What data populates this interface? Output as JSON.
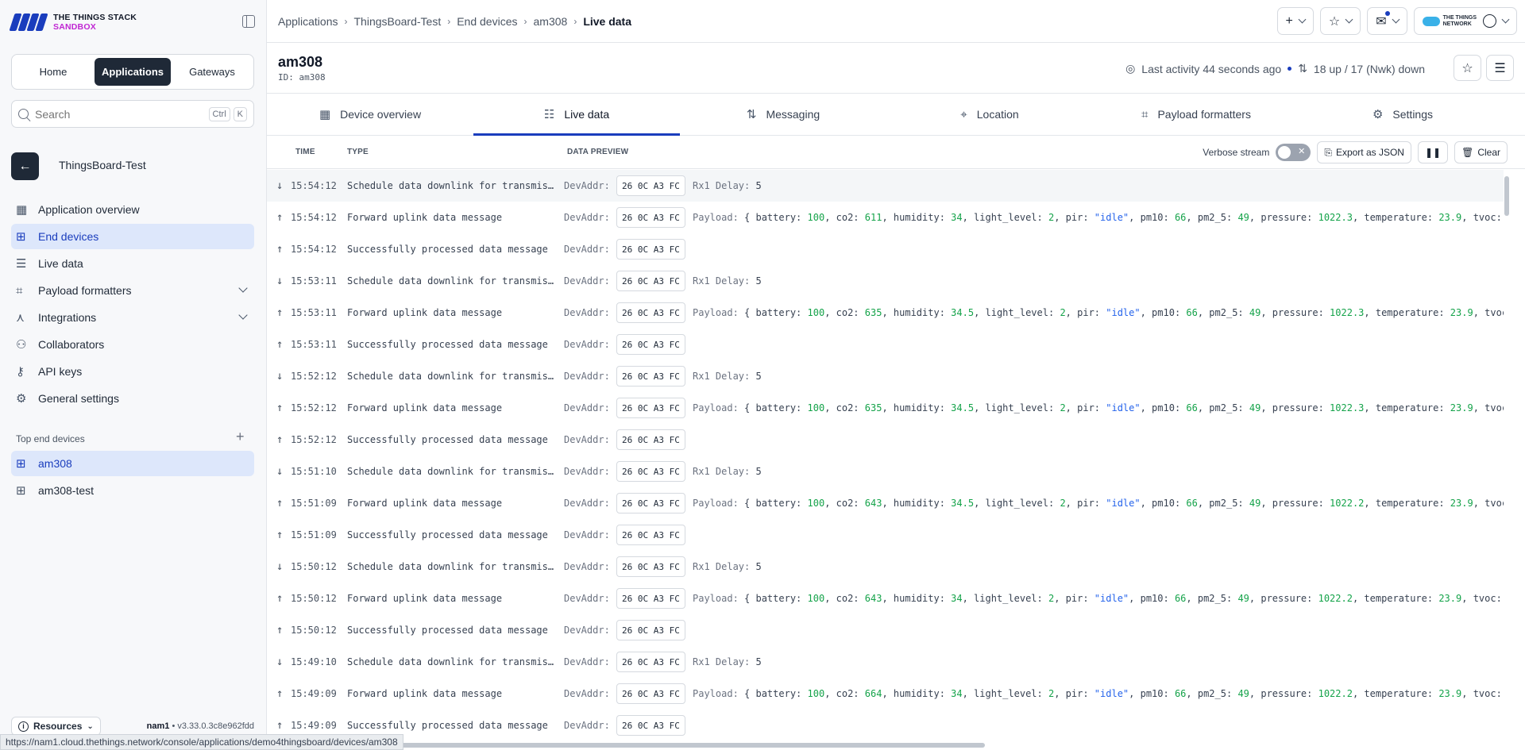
{
  "brand": {
    "line1": "THE THINGS STACK",
    "line2": "SANDBOX"
  },
  "segmented": [
    "Home",
    "Applications",
    "Gateways"
  ],
  "search": {
    "placeholder": "Search",
    "key1": "Ctrl",
    "key2": "K"
  },
  "app": {
    "name": "ThingsBoard-Test"
  },
  "nav": [
    {
      "label": "Application overview",
      "icon": "grid-icon"
    },
    {
      "label": "End devices",
      "icon": "chip-icon",
      "active": true
    },
    {
      "label": "Live data",
      "icon": "list-icon"
    },
    {
      "label": "Payload formatters",
      "icon": "code-icon"
    },
    {
      "label": "Integrations",
      "icon": "integration-icon"
    },
    {
      "label": "Collaborators",
      "icon": "users-icon"
    },
    {
      "label": "API keys",
      "icon": "key-icon"
    },
    {
      "label": "General settings",
      "icon": "gear-icon"
    }
  ],
  "top_devices": {
    "heading": "Top end devices",
    "items": [
      "am308",
      "am308-test"
    ]
  },
  "footer": {
    "resources": "Resources",
    "cluster": "nam1",
    "version": "v3.33.0.3c8e962fdd"
  },
  "breadcrumbs": [
    "Applications",
    "ThingsBoard-Test",
    "End devices",
    "am308",
    "Live data"
  ],
  "device": {
    "name": "am308",
    "id": "ID: am308",
    "last_activity": "Last activity 44 seconds ago",
    "counters": "18 up / 17 (Nwk) down"
  },
  "tabs": [
    "Device overview",
    "Live data",
    "Messaging",
    "Location",
    "Payload formatters",
    "Settings"
  ],
  "table": {
    "headers": [
      "TIME",
      "TYPE",
      "DATA PREVIEW"
    ],
    "verbose_label": "Verbose stream",
    "export_label": "Export as JSON",
    "clear_label": "Clear"
  },
  "events": [
    {
      "dir": "down",
      "time": "15:54:12",
      "type": "Schedule data downlink for transmis…",
      "addr_label": "DevAddr:",
      "addr": "26 0C A3 FC",
      "kind": "rx1",
      "extra_label": "Rx1 Delay:",
      "extra_value": "5"
    },
    {
      "dir": "up",
      "time": "15:54:12",
      "type": "Forward uplink data message",
      "addr_label": "DevAddr:",
      "addr": "26 0C A3 FC",
      "kind": "payload",
      "co2": "611",
      "humidity": "34",
      "pressure": "1022.3",
      "tail": "tvoc: :"
    },
    {
      "dir": "up",
      "time": "15:54:12",
      "type": "Successfully processed data message",
      "addr_label": "DevAddr:",
      "addr": "26 0C A3 FC",
      "kind": "none"
    },
    {
      "dir": "down",
      "time": "15:53:11",
      "type": "Schedule data downlink for transmis…",
      "addr_label": "DevAddr:",
      "addr": "26 0C A3 FC",
      "kind": "rx1",
      "extra_label": "Rx1 Delay:",
      "extra_value": "5"
    },
    {
      "dir": "up",
      "time": "15:53:11",
      "type": "Forward uplink data message",
      "addr_label": "DevAddr:",
      "addr": "26 0C A3 FC",
      "kind": "payload",
      "co2": "635",
      "humidity": "34.5",
      "pressure": "1022.3",
      "tail": "tvoc"
    },
    {
      "dir": "up",
      "time": "15:53:11",
      "type": "Successfully processed data message",
      "addr_label": "DevAddr:",
      "addr": "26 0C A3 FC",
      "kind": "none"
    },
    {
      "dir": "down",
      "time": "15:52:12",
      "type": "Schedule data downlink for transmis…",
      "addr_label": "DevAddr:",
      "addr": "26 0C A3 FC",
      "kind": "rx1",
      "extra_label": "Rx1 Delay:",
      "extra_value": "5"
    },
    {
      "dir": "up",
      "time": "15:52:12",
      "type": "Forward uplink data message",
      "addr_label": "DevAddr:",
      "addr": "26 0C A3 FC",
      "kind": "payload",
      "co2": "635",
      "humidity": "34.5",
      "pressure": "1022.3",
      "tail": "tvoc"
    },
    {
      "dir": "up",
      "time": "15:52:12",
      "type": "Successfully processed data message",
      "addr_label": "DevAddr:",
      "addr": "26 0C A3 FC",
      "kind": "none"
    },
    {
      "dir": "down",
      "time": "15:51:10",
      "type": "Schedule data downlink for transmis…",
      "addr_label": "DevAddr:",
      "addr": "26 0C A3 FC",
      "kind": "rx1",
      "extra_label": "Rx1 Delay:",
      "extra_value": "5"
    },
    {
      "dir": "up",
      "time": "15:51:09",
      "type": "Forward uplink data message",
      "addr_label": "DevAddr:",
      "addr": "26 0C A3 FC",
      "kind": "payload",
      "co2": "643",
      "humidity": "34.5",
      "pressure": "1022.2",
      "tail": "tvoc"
    },
    {
      "dir": "up",
      "time": "15:51:09",
      "type": "Successfully processed data message",
      "addr_label": "DevAddr:",
      "addr": "26 0C A3 FC",
      "kind": "none"
    },
    {
      "dir": "down",
      "time": "15:50:12",
      "type": "Schedule data downlink for transmis…",
      "addr_label": "DevAddr:",
      "addr": "26 0C A3 FC",
      "kind": "rx1",
      "extra_label": "Rx1 Delay:",
      "extra_value": "5"
    },
    {
      "dir": "up",
      "time": "15:50:12",
      "type": "Forward uplink data message",
      "addr_label": "DevAddr:",
      "addr": "26 0C A3 FC",
      "kind": "payload",
      "co2": "643",
      "humidity": "34",
      "pressure": "1022.2",
      "tail": "tvoc: :"
    },
    {
      "dir": "up",
      "time": "15:50:12",
      "type": "Successfully processed data message",
      "addr_label": "DevAddr:",
      "addr": "26 0C A3 FC",
      "kind": "none"
    },
    {
      "dir": "down",
      "time": "15:49:10",
      "type": "Schedule data downlink for transmis…",
      "addr_label": "DevAddr:",
      "addr": "26 0C A3 FC",
      "kind": "rx1",
      "extra_label": "Rx1 Delay:",
      "extra_value": "5"
    },
    {
      "dir": "up",
      "time": "15:49:09",
      "type": "Forward uplink data message",
      "addr_label": "DevAddr:",
      "addr": "26 0C A3 FC",
      "kind": "payload",
      "co2": "664",
      "humidity": "34",
      "pressure": "1022.2",
      "tail": "tvoc: :"
    },
    {
      "dir": "up",
      "time": "15:49:09",
      "type": "Successfully processed data message",
      "addr_label": "DevAddr:",
      "addr": "26 0C A3 FC",
      "kind": "none"
    }
  ],
  "payload_common": {
    "prefix": "Payload:",
    "battery": "100",
    "light_level": "2",
    "pir": "\"idle\"",
    "pm10": "66",
    "pm2_5": "49",
    "temperature": "23.9"
  },
  "status_url": "https://nam1.cloud.thethings.network/console/applications/demo4thingsboard/devices/am308",
  "colors": {
    "accent": "#1a3dbd",
    "dark": "#1f2937",
    "number": "#15a34a",
    "string": "#2563eb"
  }
}
